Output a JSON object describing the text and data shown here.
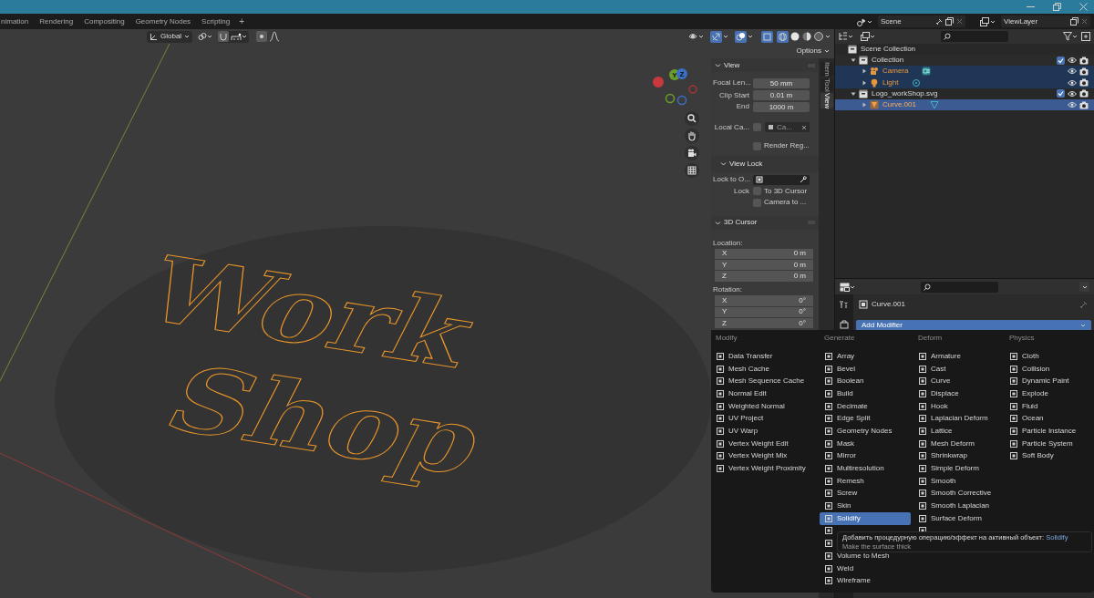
{
  "workspace_tabs": [
    {
      "label": "nimation",
      "selected": false
    },
    {
      "label": "Rendering",
      "selected": false
    },
    {
      "label": "Compositing",
      "selected": false
    },
    {
      "label": "Geometry Nodes",
      "selected": false
    },
    {
      "label": "Scripting",
      "selected": false
    }
  ],
  "add_tab": "+",
  "scene": {
    "name": "Scene"
  },
  "view_layer": {
    "name": "ViewLayer"
  },
  "viewport": {
    "orientation": "Global",
    "options": "Options",
    "gizmo_axes": [
      "Y",
      "Z"
    ],
    "object_text": [
      "Work",
      "Shop"
    ]
  },
  "sidebar": {
    "tabs": [
      {
        "label": "Item",
        "selected": false
      },
      {
        "label": "Tool",
        "selected": false
      },
      {
        "label": "View",
        "selected": true
      }
    ],
    "panels": [
      {
        "title": "View",
        "expanded": true,
        "rows": [
          {
            "kind": "field",
            "label": "Focal Len...",
            "value": "50 mm"
          },
          {
            "kind": "field",
            "label": "Clip Start",
            "value": "0.01 m"
          },
          {
            "kind": "field",
            "label": "End",
            "value": "1000 m"
          },
          {
            "kind": "object",
            "label": "Local Ca...",
            "checked": false,
            "value": "Ca..."
          },
          {
            "kind": "check",
            "text": "Render Reg...",
            "checked": false
          },
          {
            "kind": "subheader",
            "title": "View Lock",
            "expanded": true
          },
          {
            "kind": "picker",
            "label": "Lock to O..."
          },
          {
            "kind": "check",
            "label": "Lock",
            "text": "To 3D Cursor",
            "checked": false
          },
          {
            "kind": "check",
            "text": "Camera to ...",
            "checked": false
          }
        ]
      },
      {
        "title": "3D Cursor",
        "expanded": true,
        "rows": [
          {
            "kind": "caption",
            "text": "Location:"
          },
          {
            "kind": "axis",
            "label": "X",
            "value": "0 m"
          },
          {
            "kind": "axis",
            "label": "Y",
            "value": "0 m"
          },
          {
            "kind": "axis",
            "label": "Z",
            "value": "0 m"
          },
          {
            "kind": "caption",
            "text": "Rotation:"
          },
          {
            "kind": "axis",
            "label": "X",
            "value": "0°"
          },
          {
            "kind": "axis",
            "label": "Y",
            "value": "0°"
          },
          {
            "kind": "axis",
            "label": "Z",
            "value": "0°"
          }
        ]
      }
    ]
  },
  "outliner": {
    "tree": [
      {
        "label": "Scene Collection",
        "kind": "collection",
        "selected": false,
        "active": false,
        "children": [
          {
            "label": "Collection",
            "kind": "collection",
            "expanded": true,
            "checked": true,
            "selected": false,
            "active": false,
            "children": [
              {
                "label": "Camera",
                "kind": "camera",
                "expanded": false,
                "selected": true,
                "active": false
              },
              {
                "label": "Light",
                "kind": "light",
                "expanded": false,
                "selected": true,
                "active": false
              }
            ]
          },
          {
            "label": "Logo_workShop.svg",
            "kind": "collection",
            "expanded": true,
            "checked": true,
            "selected": false,
            "active": false,
            "children": [
              {
                "label": "Curve.001",
                "kind": "curve",
                "expanded": false,
                "selected": true,
                "active": true
              }
            ]
          }
        ]
      }
    ]
  },
  "properties": {
    "object": "Curve.001",
    "add_modifier": "Add Modifier"
  },
  "modifier_menu": {
    "columns": [
      {
        "title": "Modify",
        "items": [
          {
            "label": "Data Transfer",
            "selected": false
          },
          {
            "label": "Mesh Cache",
            "selected": false
          },
          {
            "label": "Mesh Sequence Cache",
            "selected": false
          },
          {
            "label": "Normal Edit",
            "selected": false
          },
          {
            "label": "Weighted Normal",
            "selected": false
          },
          {
            "label": "UV Project",
            "selected": false
          },
          {
            "label": "UV Warp",
            "selected": false
          },
          {
            "label": "Vertex Weight Edit",
            "selected": false
          },
          {
            "label": "Vertex Weight Mix",
            "selected": false
          },
          {
            "label": "Vertex Weight Proximity",
            "selected": false
          }
        ]
      },
      {
        "title": "Generate",
        "items": [
          {
            "kind": "entry",
            "label": "Array",
            "selected": false
          },
          {
            "kind": "entry",
            "label": "Bevel",
            "selected": false
          },
          {
            "kind": "entry",
            "label": "Boolean",
            "selected": false
          },
          {
            "kind": "entry",
            "label": "Build",
            "selected": false
          },
          {
            "kind": "entry",
            "label": "Decimate",
            "selected": false
          },
          {
            "kind": "entry",
            "label": "Edge Split",
            "selected": false
          },
          {
            "kind": "entry",
            "label": "Geometry Nodes",
            "selected": false
          },
          {
            "kind": "entry",
            "label": "Mask",
            "selected": false
          },
          {
            "kind": "entry",
            "label": "Mirror",
            "selected": false
          },
          {
            "kind": "entry",
            "label": "Multiresolution",
            "selected": false
          },
          {
            "kind": "entry",
            "label": "Remesh",
            "selected": false
          },
          {
            "kind": "entry",
            "label": "Screw",
            "selected": false
          },
          {
            "kind": "entry",
            "label": "Skin",
            "selected": false
          },
          {
            "kind": "entry",
            "label": "Solidify",
            "selected": true
          },
          {
            "kind": "covered"
          },
          {
            "kind": "covered"
          },
          {
            "kind": "entry",
            "label": "Volume to Mesh",
            "selected": false
          },
          {
            "kind": "entry",
            "label": "Weld",
            "selected": false
          },
          {
            "kind": "entry",
            "label": "Wireframe",
            "selected": false
          }
        ]
      },
      {
        "title": "Deform",
        "items": [
          {
            "kind": "entry",
            "label": "Armature",
            "selected": false
          },
          {
            "kind": "entry",
            "label": "Cast",
            "selected": false
          },
          {
            "kind": "entry",
            "label": "Curve",
            "selected": false
          },
          {
            "kind": "entry",
            "label": "Displace",
            "selected": false
          },
          {
            "kind": "entry",
            "label": "Hook",
            "selected": false
          },
          {
            "kind": "entry",
            "label": "Laplacian Deform",
            "selected": false
          },
          {
            "kind": "entry",
            "label": "Lattice",
            "selected": false
          },
          {
            "kind": "entry",
            "label": "Mesh Deform",
            "selected": false
          },
          {
            "kind": "entry",
            "label": "Shrinkwrap",
            "selected": false
          },
          {
            "kind": "entry",
            "label": "Simple Deform",
            "selected": false
          },
          {
            "kind": "entry",
            "label": "Smooth",
            "selected": false
          },
          {
            "kind": "entry",
            "label": "Smooth Corrective",
            "selected": false
          },
          {
            "kind": "entry",
            "label": "Smooth Laplacian",
            "selected": false
          },
          {
            "kind": "entry",
            "label": "Surface Deform",
            "selected": false
          },
          {
            "kind": "covered"
          }
        ]
      },
      {
        "title": "Physics",
        "items": [
          {
            "label": "Cloth",
            "selected": false
          },
          {
            "label": "Collision",
            "selected": false
          },
          {
            "label": "Dynamic Paint",
            "selected": false
          },
          {
            "label": "Explode",
            "selected": false
          },
          {
            "label": "Fluid",
            "selected": false
          },
          {
            "label": "Ocean",
            "selected": false
          },
          {
            "label": "Particle Instance",
            "selected": false
          },
          {
            "label": "Particle System",
            "selected": false
          },
          {
            "label": "Soft Body",
            "selected": false
          }
        ]
      }
    ]
  },
  "tooltip": {
    "text": "Добавить процедурную операцию/эффект на активный объект:",
    "operator": "Solidify",
    "description": "Make the surface thick"
  }
}
